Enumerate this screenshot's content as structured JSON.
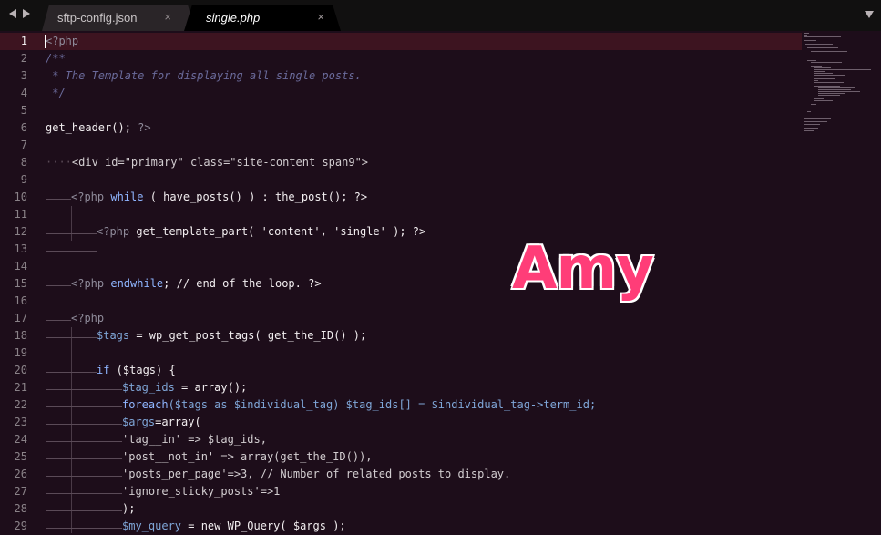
{
  "tabs": [
    {
      "label": "sftp-config.json",
      "close": "×",
      "active": false
    },
    {
      "label": "single.php",
      "close": "×",
      "active": true
    }
  ],
  "overlay_text": "Amy",
  "line_numbers": [
    "1",
    "2",
    "3",
    "4",
    "5",
    "6",
    "7",
    "8",
    "9",
    "10",
    "11",
    "12",
    "13",
    "14",
    "15",
    "16",
    "17",
    "18",
    "19",
    "20",
    "21",
    "22",
    "23",
    "24",
    "25",
    "26",
    "27",
    "28",
    "29"
  ],
  "code": {
    "l1": "<?php",
    "l2": "/**",
    "l3": " * The Template for displaying all single posts.",
    "l4": " */",
    "l6_fn": "get_header();",
    "l6_end": " ?>",
    "l8_a": "<div",
    "l8_b": " id=\"primary\" class=\"site-content span9\">",
    "l10_a": "<?php",
    "l10_b": " while",
    "l10_c": " ( have_posts() ) : the_post(); ?>",
    "l12_a": "<?php",
    "l12_b": " get_template_part( 'content', 'single' ); ?>",
    "l15_a": "<?php",
    "l15_b": " endwhile",
    "l15_c": "; // end of the loop. ?>",
    "l17": "<?php",
    "l18_v": "$tags",
    "l18_r": " = wp_get_post_tags( get_the_ID() );",
    "l20_k": "if",
    "l20_r": " ($tags) {",
    "l21_v": "$tag_ids",
    "l21_r": " = array();",
    "l22_k": "foreach",
    "l22_r": "($tags as $individual_tag) $tag_ids[] = $individual_tag->term_id;",
    "l23_v": "$args",
    "l23_r": "=array(",
    "l24": "'tag__in' => $tag_ids,",
    "l25": "'post__not_in' => array(get_the_ID()),",
    "l26": "'posts_per_page'=>3, // Number of related posts to display.",
    "l27": "'ignore_sticky_posts'=>1",
    "l28": ");",
    "l29_v": "$my_query",
    "l29_r": " = new WP_Query( $args );"
  },
  "colors": {
    "background": "#1d0d1a",
    "tabbar": "#111010",
    "current_line": "#3d1420",
    "overlay": "#ff3d78"
  }
}
